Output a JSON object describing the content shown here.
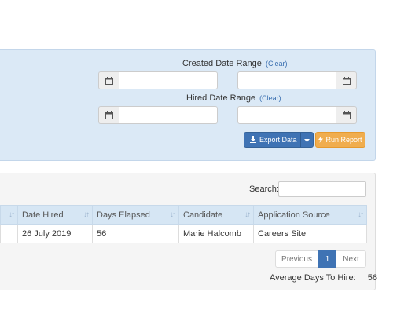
{
  "filters": {
    "created_label": "Created Date Range",
    "hired_label": "Hired Date Range",
    "clear_label": "(Clear)",
    "export_label": "Export Data",
    "run_label": "Run Report"
  },
  "results": {
    "search_label": "Search:",
    "columns": [
      "Date Hired",
      "Days Elapsed",
      "Candidate",
      "Application Source"
    ],
    "rows": [
      [
        "26 July 2019",
        "56",
        "Marie Halcomb",
        "Careers Site"
      ]
    ],
    "pagination": {
      "prev": "Previous",
      "current": "1",
      "next": "Next"
    },
    "average_label": "Average Days To Hire:",
    "average_value": "56"
  },
  "colors": {
    "accent": "#3f73b4",
    "run_button": "#f0ad4e",
    "panel": "#dbe9f6"
  },
  "icons": [
    "calendar-icon",
    "download-icon",
    "caret-down-icon",
    "bolt-icon",
    "sort-icon"
  ]
}
